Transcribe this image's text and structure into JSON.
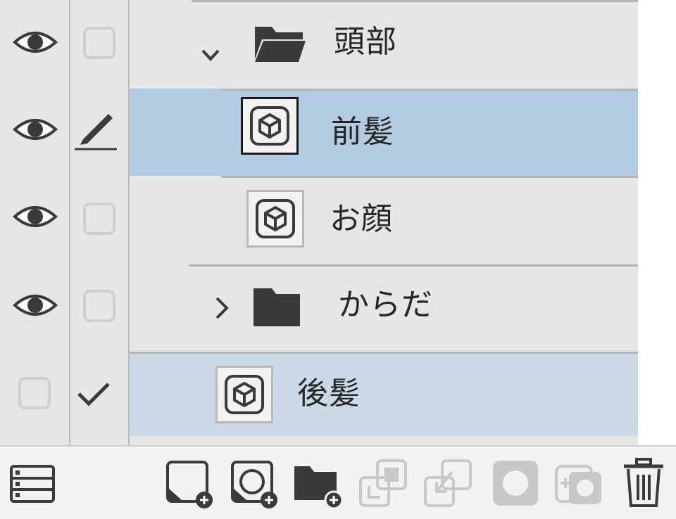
{
  "layers": [
    {
      "name": "頭部",
      "kind": "folder",
      "expanded": true
    },
    {
      "name": "前髪",
      "kind": "layer",
      "selected": true,
      "editing": true
    },
    {
      "name": "お顔",
      "kind": "layer"
    },
    {
      "name": "からだ",
      "kind": "folder",
      "expanded": false
    },
    {
      "name": "後髪",
      "kind": "layer",
      "hidden": true,
      "reference": true
    }
  ],
  "colors": {
    "selected_row": "#b3cce3",
    "secondary_selected_row": "#cad9e5",
    "panel_bg": "#e6e6e6",
    "icon_dark": "#3a3a3a",
    "icon_disabled": "#c8c8c8"
  },
  "toolbar": {
    "icons": [
      "layer-list-icon",
      "new-raster-layer-icon",
      "new-vector-layer-icon",
      "new-folder-icon",
      "transfer-down-icon",
      "merge-down-icon",
      "mask-icon",
      "apply-mask-icon",
      "delete-layer-icon"
    ]
  }
}
